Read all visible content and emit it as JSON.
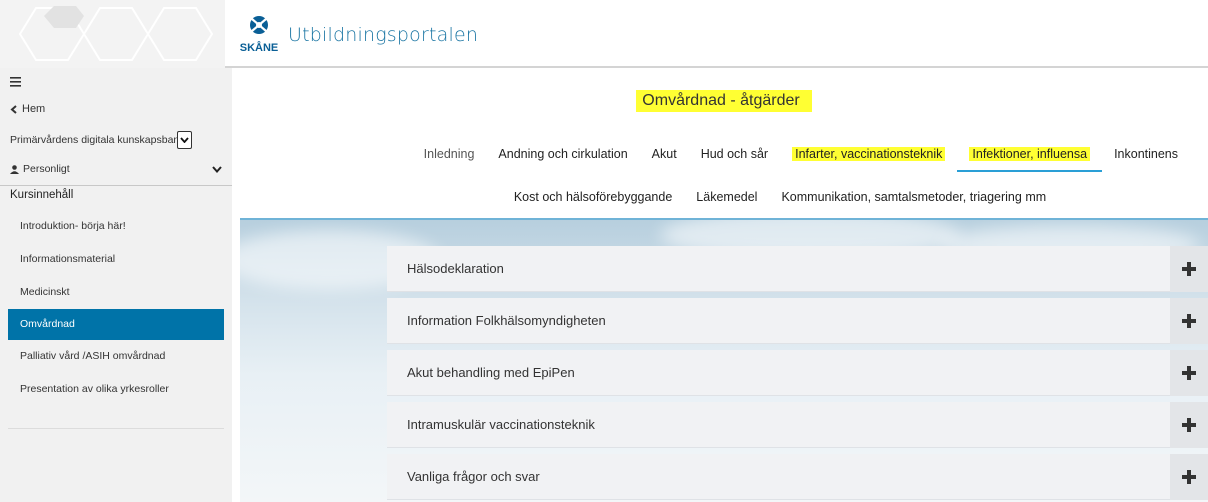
{
  "header": {
    "logo_text": "SKÅNE",
    "title": "Utbildningsportalen"
  },
  "sidebar": {
    "menu_icon": "hamburger-icon",
    "home_label": "Hem",
    "course_select_value": "Primärvårdens digitala kunskapsbank",
    "personal_label": "Personligt",
    "section_heading": "Kursinnehåll",
    "items": [
      {
        "label": "Introduktion- börja här!",
        "active": false
      },
      {
        "label": "Informationsmaterial",
        "active": false
      },
      {
        "label": "Medicinskt",
        "active": false
      },
      {
        "label": "Omvårdnad",
        "active": true
      },
      {
        "label": "Palliativ vård /ASIH omvårdnad",
        "active": false
      },
      {
        "label": "Presentation av olika yrkesroller",
        "active": false
      }
    ]
  },
  "main": {
    "page_title": "Omvårdnad - åtgärder",
    "tabs_row1": [
      {
        "label": "Inledning"
      },
      {
        "label": "Andning och cirkulation"
      },
      {
        "label": "Akut"
      },
      {
        "label": "Hud och sår"
      },
      {
        "label": "Infarter, vaccinationsteknik"
      },
      {
        "label": "Infektioner, influensa"
      },
      {
        "label": "Inkontinens"
      }
    ],
    "tabs_row2": [
      {
        "label": "Kost och hälsoförebyggande"
      },
      {
        "label": "Läkemedel"
      },
      {
        "label": "Kommunikation, samtalsmetoder, triagering mm"
      }
    ],
    "accordion": [
      {
        "title": "Hälsodeklaration"
      },
      {
        "title": "Information Folkhälsomyndigheten"
      },
      {
        "title": "Akut behandling med EpiPen"
      },
      {
        "title": "Intramuskulär vaccinationsteknik"
      },
      {
        "title": "Vanliga frågor och svar"
      }
    ]
  },
  "colors": {
    "accent": "#0073a8",
    "brand_text": "#1a75a3",
    "highlight": "#ffff33",
    "active_tab_underline": "#2a9fd6"
  }
}
